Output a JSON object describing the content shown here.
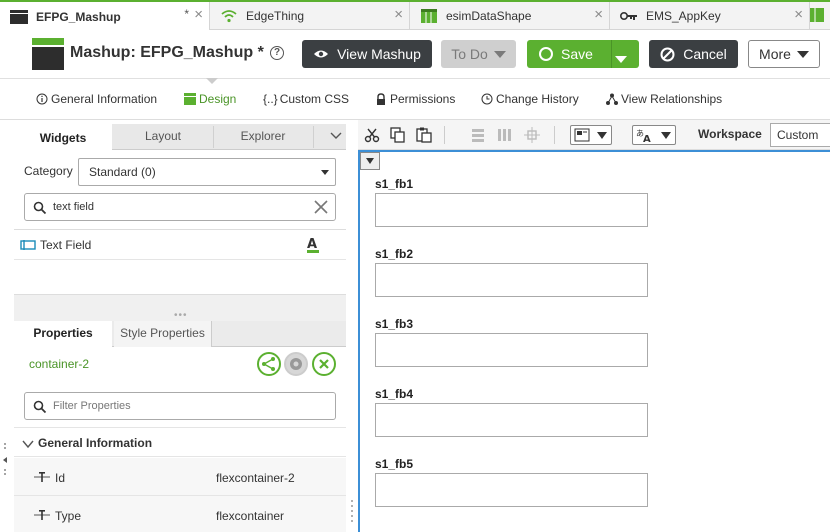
{
  "tabs": [
    {
      "label": "EFPG_Mashup",
      "modified": "*",
      "icon": "mashup-icon"
    },
    {
      "label": "EdgeThing",
      "icon": "wifi-icon"
    },
    {
      "label": "esimDataShape",
      "icon": "datashape-icon"
    },
    {
      "label": "EMS_AppKey",
      "icon": "key-icon"
    }
  ],
  "header": {
    "title": "Mashup: EFPG_Mashup *",
    "help": "?",
    "view_label": "View Mashup",
    "todo_label": "To Do",
    "save_label": "Save",
    "cancel_label": "Cancel",
    "more_label": "More"
  },
  "subnav": [
    {
      "label": "General Information",
      "icon": "info-icon"
    },
    {
      "label": "Design",
      "icon": "design-icon",
      "active": true
    },
    {
      "label": "Custom CSS",
      "icon": "css-icon"
    },
    {
      "label": "Permissions",
      "icon": "lock-icon"
    },
    {
      "label": "Change History",
      "icon": "history-icon"
    },
    {
      "label": "View Relationships",
      "icon": "relationships-icon"
    }
  ],
  "left_tabs": [
    "Widgets",
    "Layout",
    "Explorer"
  ],
  "widgets": {
    "category_label": "Category",
    "category_value": "Standard (0)",
    "search_value": "text field",
    "results": [
      {
        "label": "Text Field"
      }
    ]
  },
  "properties": {
    "tabs": [
      "Properties",
      "Style Properties"
    ],
    "container_name": "container-2",
    "filter_placeholder": "Filter Properties",
    "section": "General Information",
    "rows": [
      {
        "name": "Id",
        "value": "flexcontainer-2"
      },
      {
        "name": "Type",
        "value": "flexcontainer"
      }
    ]
  },
  "toolbar": {
    "workspace_label": "Workspace",
    "workspace_value": "Custom"
  },
  "canvas": {
    "fields": [
      "s1_fb1",
      "s1_fb2",
      "s1_fb3",
      "s1_fb4",
      "s1_fb5"
    ]
  },
  "colors": {
    "accent": "#5bb030",
    "dark_button": "#3b3f42",
    "selection": "#3c8fd6"
  }
}
